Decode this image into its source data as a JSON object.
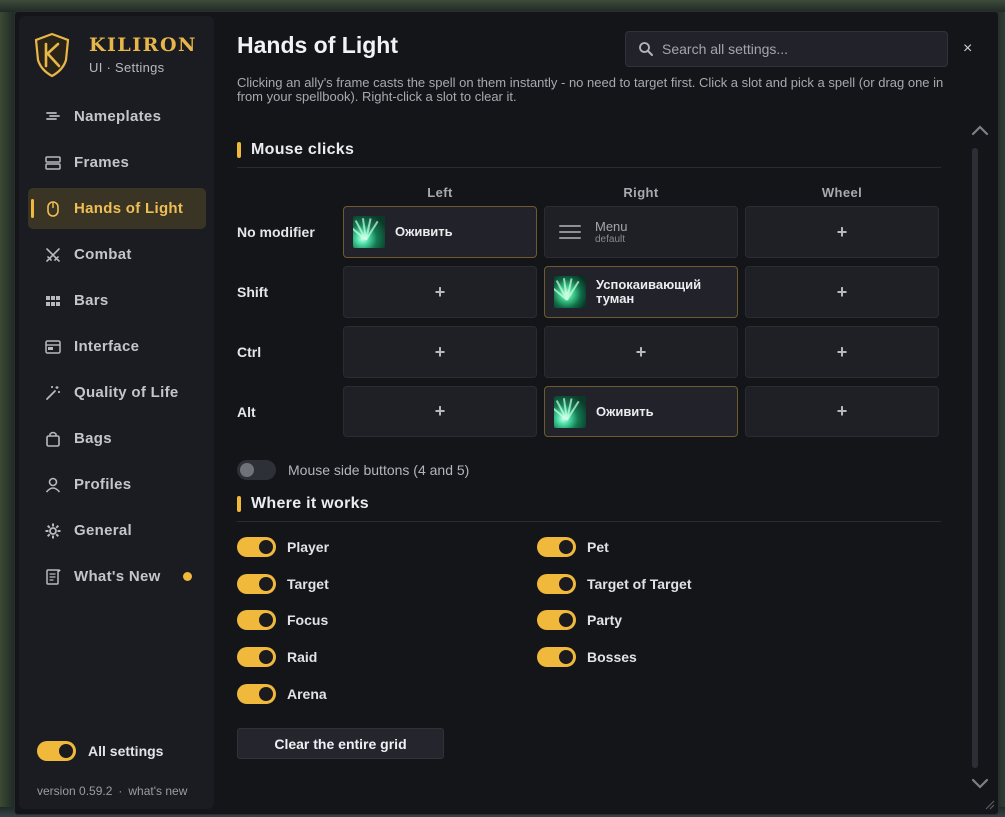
{
  "brand": {
    "name": "KILIRON",
    "subtitle": "UI · Settings"
  },
  "nav": [
    {
      "label": "Nameplates",
      "icon": "nameplate-icon",
      "active": false
    },
    {
      "label": "Frames",
      "icon": "frames-icon",
      "active": false
    },
    {
      "label": "Hands of Light",
      "icon": "mouse-icon",
      "active": true
    },
    {
      "label": "Combat",
      "icon": "crossed-swords-icon",
      "active": false
    },
    {
      "label": "Bars",
      "icon": "grid-icon",
      "active": false
    },
    {
      "label": "Interface",
      "icon": "interface-icon",
      "active": false
    },
    {
      "label": "Quality of Life",
      "icon": "magic-wand-icon",
      "active": false
    },
    {
      "label": "Bags",
      "icon": "bag-icon",
      "active": false
    },
    {
      "label": "Profiles",
      "icon": "user-icon",
      "active": false
    },
    {
      "label": "General",
      "icon": "gear-icon",
      "active": false
    },
    {
      "label": "What's New",
      "icon": "news-icon",
      "active": false,
      "badge": true
    }
  ],
  "footer": {
    "all_settings_label": "All settings",
    "all_settings_on": true,
    "version": "version 0.59.2",
    "sep": "·",
    "whats_new_link": "what's new"
  },
  "header": {
    "title": "Hands of Light",
    "search_placeholder": "Search all settings...",
    "close": "×"
  },
  "description": "Clicking an ally's frame casts the spell on them instantly - no need to target first. Click a slot and pick a spell (or drag one in from your spellbook). Right-click a slot to clear it.",
  "mouse_clicks": {
    "title": "Mouse clicks",
    "columns": [
      "Left",
      "Right",
      "Wheel"
    ],
    "rows": [
      {
        "label": "No modifier",
        "slots": [
          {
            "type": "spell",
            "name": "Оживить",
            "icon": "revive-icon"
          },
          {
            "type": "menu",
            "name": "Menu",
            "sub": "default"
          },
          {
            "type": "empty",
            "name": "+"
          }
        ]
      },
      {
        "label": "Shift",
        "slots": [
          {
            "type": "empty",
            "name": "+"
          },
          {
            "type": "spell",
            "name": "Успокаивающий туман",
            "icon": "mist-icon"
          },
          {
            "type": "empty",
            "name": "+"
          }
        ]
      },
      {
        "label": "Ctrl",
        "slots": [
          {
            "type": "empty",
            "name": "+"
          },
          {
            "type": "empty",
            "name": "+"
          },
          {
            "type": "empty",
            "name": "+"
          }
        ]
      },
      {
        "label": "Alt",
        "slots": [
          {
            "type": "empty",
            "name": "+"
          },
          {
            "type": "spell",
            "name": "Оживить",
            "icon": "revive-icon"
          },
          {
            "type": "empty",
            "name": "+"
          }
        ]
      }
    ],
    "side_buttons": {
      "label": "Mouse side buttons (4 and 5)",
      "on": false
    }
  },
  "where_it_works": {
    "title": "Where it works",
    "left": [
      {
        "label": "Player",
        "on": true
      },
      {
        "label": "Target",
        "on": true
      },
      {
        "label": "Focus",
        "on": true
      },
      {
        "label": "Raid",
        "on": true
      },
      {
        "label": "Arena",
        "on": true
      }
    ],
    "right": [
      {
        "label": "Pet",
        "on": true
      },
      {
        "label": "Target of Target",
        "on": true
      },
      {
        "label": "Party",
        "on": true
      },
      {
        "label": "Bosses",
        "on": true
      }
    ]
  },
  "clear_button": "Clear the entire grid",
  "colors": {
    "accent": "#f0b93c",
    "panel": "#141519",
    "sidebar": "#1b1c21",
    "slot": "#1f2026"
  }
}
